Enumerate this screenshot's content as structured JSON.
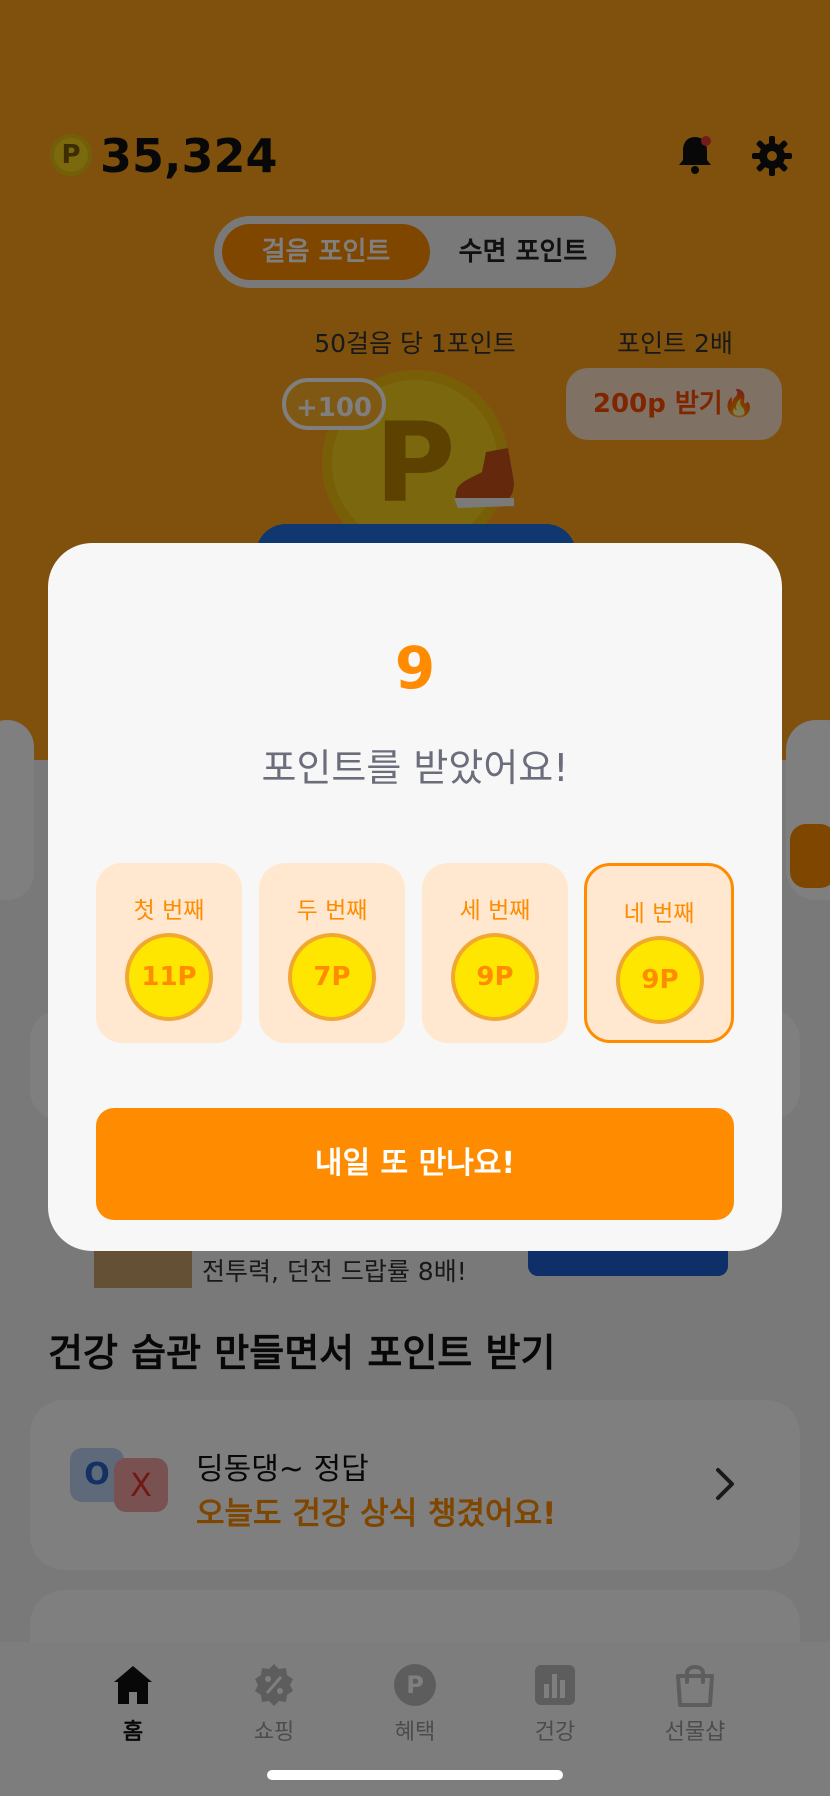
{
  "header": {
    "coin_symbol": "P",
    "total_points": "35,324"
  },
  "tabs": [
    {
      "label": "걸음 포인트",
      "active": true
    },
    {
      "label": "수면 포인트",
      "active": false
    }
  ],
  "rewards": {
    "rate_text": "50걸음 당 1포인트",
    "double_text": "포인트 2배",
    "double_button": "200p 받기🔥",
    "bonus_badge": "+100",
    "big_coin_symbol": "P"
  },
  "promo": {
    "text": "전투력, 던전 드랍률 8배!"
  },
  "section": {
    "title": "건강 습관 만들면서 포인트 받기"
  },
  "quiz": {
    "icon_o": "O",
    "icon_x": "X",
    "title": "딩동댕~ 정답",
    "subtitle": "오늘도 건강 상식 챙겼어요!"
  },
  "nav": [
    {
      "label": "홈",
      "icon": "home-icon",
      "active": true
    },
    {
      "label": "쇼핑",
      "icon": "discount-icon",
      "active": false
    },
    {
      "label": "혜택",
      "icon": "point-icon",
      "active": false
    },
    {
      "label": "건강",
      "icon": "chart-icon",
      "active": false
    },
    {
      "label": "선물샵",
      "icon": "shopping-bag-icon",
      "active": false
    }
  ],
  "modal": {
    "points": "9",
    "message": "포인트를 받았어요!",
    "days": [
      {
        "label": "첫 번째",
        "value": "11P"
      },
      {
        "label": "두 번째",
        "value": "7P"
      },
      {
        "label": "세 번째",
        "value": "9P"
      },
      {
        "label": "네 번째",
        "value": "9P"
      }
    ],
    "button": "내일 또 만나요!"
  },
  "colors": {
    "accent": "#ff8c00",
    "header_bg": "#ffa31a",
    "coin": "#ffe600"
  }
}
